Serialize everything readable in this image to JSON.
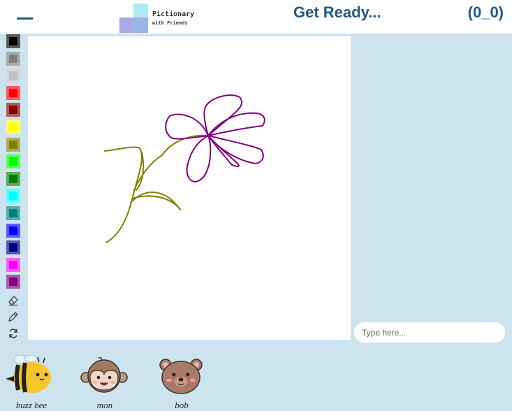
{
  "header": {
    "logo_title": "Pictionary",
    "logo_subtitle": "with Friends",
    "status": "Get Ready...",
    "score": "(0_0)"
  },
  "palette": {
    "colors": [
      "#000000",
      "#808080",
      "#c0c0c0",
      "#ff0000",
      "#800000",
      "#ffff00",
      "#808000",
      "#00ff00",
      "#008000",
      "#00ffff",
      "#008080",
      "#0000ff",
      "#000080",
      "#ff00ff",
      "#800080"
    ],
    "tools": [
      "eraser-icon",
      "pencil-icon",
      "refresh-icon"
    ]
  },
  "drawing": {
    "petal_color": "#800080",
    "stem_color": "#808000"
  },
  "chat": {
    "placeholder": "Type here..."
  },
  "players": [
    {
      "name": "buzz bee",
      "avatar": "bee-avatar-icon"
    },
    {
      "name": "mon",
      "avatar": "monkey-avatar-icon"
    },
    {
      "name": "bob",
      "avatar": "bear-avatar-icon"
    }
  ]
}
